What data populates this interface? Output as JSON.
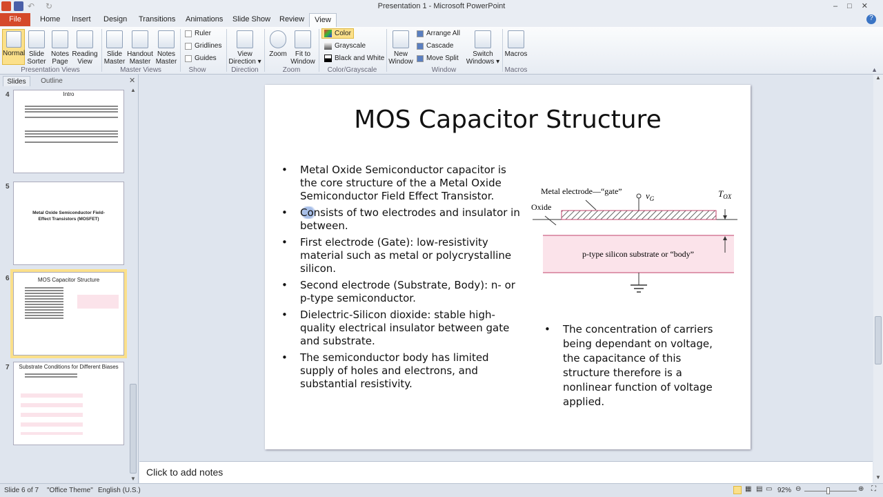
{
  "window": {
    "title": "Presentation 1  -  Microsoft PowerPoint"
  },
  "tabs": [
    "File",
    "Home",
    "Insert",
    "Design",
    "Transitions",
    "Animations",
    "Slide Show",
    "Review",
    "View"
  ],
  "ribbon": {
    "presentation_views": {
      "label": "Presentation Views",
      "items": [
        "Normal",
        "Slide Sorter",
        "Notes Page",
        "Reading View"
      ]
    },
    "master_views": {
      "label": "Master Views",
      "items": [
        "Slide Master",
        "Handout Master",
        "Notes Master"
      ]
    },
    "show": {
      "label": "Show",
      "items": [
        "Ruler",
        "Gridlines",
        "Guides"
      ]
    },
    "direction": {
      "label": "Direction",
      "item": "View Direction"
    },
    "zoom": {
      "label": "Zoom",
      "items": [
        "Zoom",
        "Fit to Window"
      ]
    },
    "color": {
      "label": "Color/Grayscale",
      "items": [
        "Color",
        "Grayscale",
        "Black and White"
      ]
    },
    "window": {
      "label": "Window",
      "new": "New Window",
      "items": [
        "Arrange All",
        "Cascade",
        "Move Split"
      ],
      "switch": "Switch Windows"
    },
    "macros": {
      "label": "Macros",
      "item": "Macros"
    }
  },
  "panel": {
    "tabs": [
      "Slides",
      "Outline"
    ],
    "thumbs": [
      {
        "num": "4",
        "title": "Intro"
      },
      {
        "num": "5",
        "title": "Metal Oxide Semiconductor Field-Effect Transistors (MOSFET)"
      },
      {
        "num": "6",
        "title": "MOS Capacitor Structure"
      },
      {
        "num": "7",
        "title": "Substrate Conditions for Different Biases"
      }
    ]
  },
  "slide": {
    "title": "MOS Capacitor Structure",
    "bullets": [
      "Metal Oxide Semiconductor capacitor is the core structure of the a Metal Oxide Semiconductor Field Effect Transistor.",
      "Consists of two electrodes and insulator in between.",
      "First electrode (Gate): low-resistivity material such as metal or polycrystalline silicon.",
      "Second electrode (Substrate, Body): n- or p-type semiconductor.",
      "Dielectric-Silicon dioxide: stable high-quality electrical insulator between gate and substrate.",
      "The semiconductor body has limited supply of holes and electrons, and substantial resistivity."
    ],
    "right_bullet": "The concentration of carriers being dependant on voltage, the capacitance of this structure therefore is a nonlinear function of voltage applied.",
    "diagram": {
      "gate_label": "Metal electrode—“gate”",
      "oxide_label": "Oxide",
      "vg": "v",
      "vg_sub": "G",
      "tox": "T",
      "tox_sub": "OX",
      "substrate": "p-type silicon substrate or “body”"
    }
  },
  "notes": {
    "placeholder": "Click to add notes"
  },
  "status": {
    "slide": "Slide 6 of 7",
    "theme": "\"Office Theme\"",
    "lang": "English (U.S.)",
    "zoom": "92%"
  },
  "colors": {
    "file_tab": "#d5492a",
    "selected": "#fbe08a",
    "substrate": "#fbe3ea",
    "gate_outline": "#c2406a"
  }
}
